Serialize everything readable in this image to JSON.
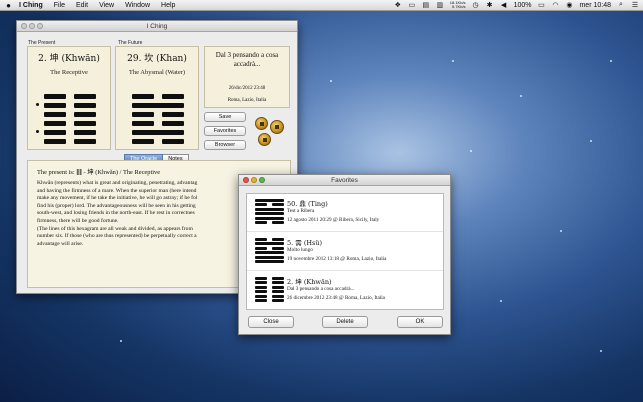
{
  "menubar": {
    "app_name": "I Ching",
    "menus": [
      "File",
      "Edit",
      "View",
      "Window",
      "Help"
    ],
    "net_up": "18.1Kb/s",
    "net_down": "5.7Kb/s",
    "battery": "100%",
    "clock": "mer 10:48"
  },
  "main_window": {
    "title": "I Ching",
    "present": {
      "label": "The Present",
      "name": "2. 坤 (Khwăn)",
      "subtitle": "The Receptive",
      "lines_top_to_bottom": [
        "yin",
        "yin",
        "yin",
        "yin",
        "yin",
        "yin"
      ],
      "changing_lines_top_to_bottom": [
        false,
        false,
        true,
        false,
        false,
        true
      ]
    },
    "future": {
      "label": "The Future",
      "name": "29. 坎 (Khan)",
      "subtitle": "The Abysmal (Water)",
      "lines_top_to_bottom": [
        "yin",
        "yang",
        "yin",
        "yin",
        "yang",
        "yin"
      ]
    },
    "note": {
      "text": "Dal 3 pensando a cosa accadrà...",
      "date": "26/dic/2012 23:48",
      "place": "Roma, Lazio, Italia"
    },
    "buttons": {
      "save": "Save",
      "favorites": "Favorites",
      "browser": "Browser"
    },
    "tabs": {
      "oracle": "The Oracle",
      "notes": "Notes"
    },
    "oracle": {
      "lead": "The present is: ䷁ - 坤 (Khwăn) / The Receptive",
      "body": "Khwăn (represents) what is great and originating, penetrating, advantag\nand having the firmness of a mare. When the superior man (here intend\nmake any movement, if he take the initiative, he will go astray; if he fol\nfind his (proper) lord. The advantageousness will be seen in his getting\nsouth-west, and losing friends in the north-east. If he rest in correctnes\nfirmness, there will be good fortune.\n(The lines of this hexagram are all weak and divided, as appears from\nnumber six. If those (who are thus represented) be perpetually correct a\nadvantage will arise."
    }
  },
  "favorites_window": {
    "title": "Favorites",
    "items": [
      {
        "title": "50. 鼎 (Ting)",
        "note": "Test a Ribera",
        "date": "12 agosto 2011 20:29 @ Ribera, Sicily, Italy",
        "lines_top_to_bottom": [
          "yang",
          "yin",
          "yang",
          "yang",
          "yang",
          "yin"
        ]
      },
      {
        "title": "5. 需 (Hsü)",
        "note": "Molto lungo",
        "date": "19 novembre 2012 13:18 @ Roma, Lazio, Italia",
        "lines_top_to_bottom": [
          "yin",
          "yang",
          "yin",
          "yang",
          "yang",
          "yang"
        ]
      },
      {
        "title": "2. 坤 (Khwăn)",
        "note": "Dal 3 pensando a cosa accadrà...",
        "date": "26 dicembre 2012 23:48 @ Roma, Lazio, Italia",
        "lines_top_to_bottom": [
          "yin",
          "yin",
          "yin",
          "yin",
          "yin",
          "yin"
        ]
      }
    ],
    "buttons": {
      "close": "Close",
      "delete": "Delete",
      "ok": "OK"
    }
  }
}
